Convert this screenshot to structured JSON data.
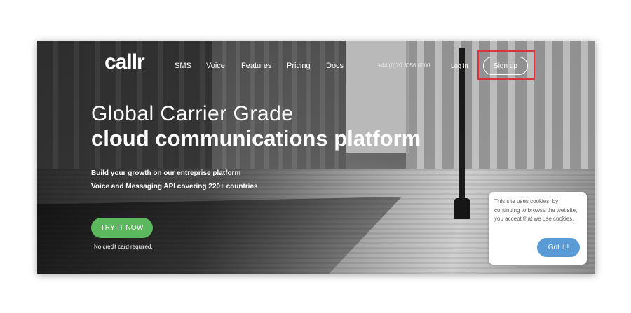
{
  "brand": {
    "logo_text": "callr"
  },
  "nav": {
    "items": [
      {
        "label": "SMS"
      },
      {
        "label": "Voice"
      },
      {
        "label": "Features"
      },
      {
        "label": "Pricing"
      },
      {
        "label": "Docs"
      }
    ],
    "phone": "+44 (0)20 3056 8900",
    "login": "Log in",
    "signup": "Sign up"
  },
  "hero": {
    "title_line1": "Global Carrier Grade",
    "title_line2": "cloud communications platform",
    "subtitle_line1": "Build your growth on our entreprise platform",
    "subtitle_line2": "Voice and Messaging API covering 220+ countries",
    "cta": "TRY IT NOW",
    "cta_note": "No credit card required."
  },
  "cookie_notice": {
    "text": "This site uses cookies, by continuing to browse the website, you accept that we use cookies.",
    "button": "Got it !"
  },
  "colors": {
    "cta": "#5cb85c",
    "cookie_button": "#5b9bd5",
    "highlight": "#d8343c"
  }
}
